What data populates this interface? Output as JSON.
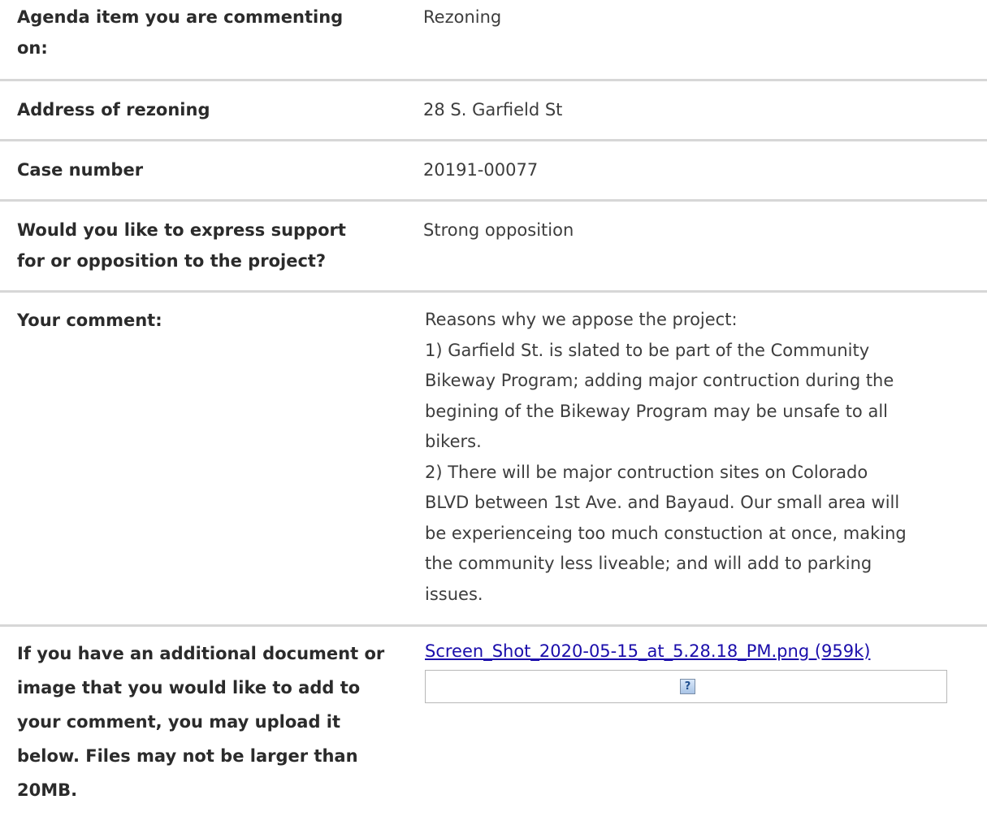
{
  "rows": [
    {
      "label": "Agenda item you are commenting on:",
      "value": "Rezoning"
    },
    {
      "label": "Address of rezoning",
      "value": "28 S. Garfield St"
    },
    {
      "label": "Case number",
      "value": "20191-00077"
    },
    {
      "label": "Would you like to express support for or opposition to the project?",
      "value": "Strong opposition"
    },
    {
      "label": "Your comment:",
      "value_lines": [
        "Reasons why we appose the project:",
        "1) Garfield St. is slated to be part of the Community",
        "Bikeway Program; adding major contruction during the",
        "begining of the Bikeway Program may be unsafe to all",
        "bikers.",
        "2) There will be major contruction sites on Colorado",
        "BLVD between 1st Ave. and Bayaud. Our small area will",
        "be experienceing too much constuction at once, making",
        "the community less liveable; and will add to parking",
        "issues."
      ]
    },
    {
      "label": "If you have an additional document or image that you would like to add to your comment, you may upload it below. Files may not be larger than 20MB.",
      "attachment_link": "Screen_Shot_2020-05-15_at_5.28.18_PM.png (959k)",
      "preview_icon": "broken-image-icon",
      "preview_icon_glyph": "?"
    }
  ],
  "colors": {
    "divider": "#d7d7d7",
    "link": "#1a0dab",
    "label_text": "#2b2b2b",
    "value_text": "#3d3d3d"
  }
}
